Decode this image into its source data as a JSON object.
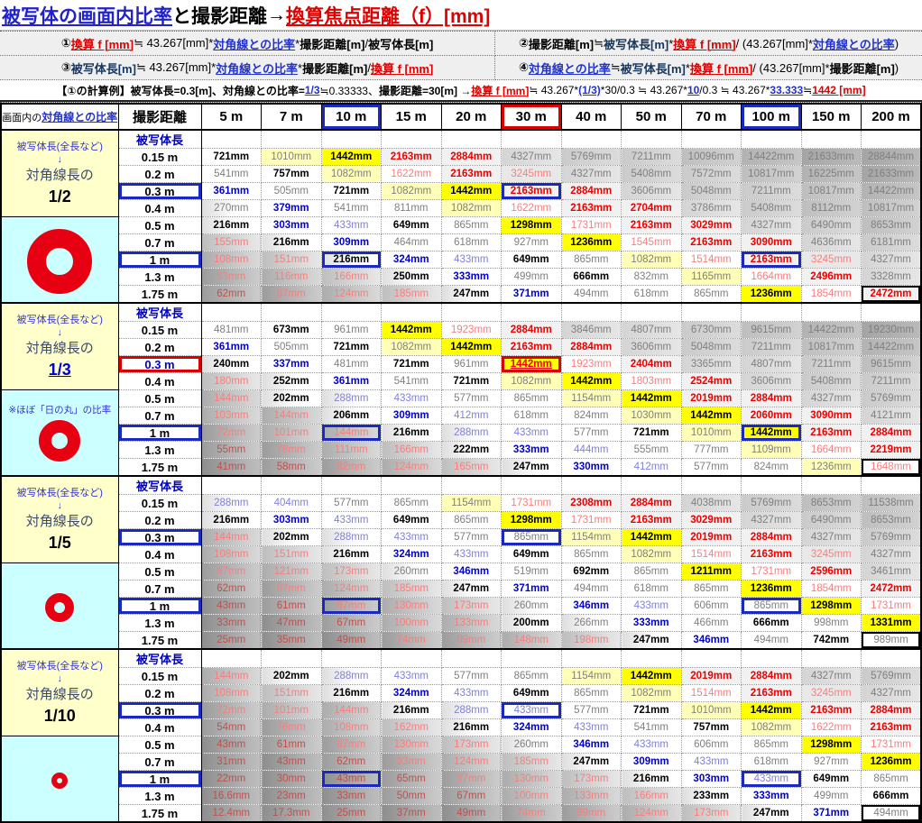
{
  "title": {
    "subject": "被写体の画面内比率",
    "to": "と",
    "distance": "撮影距離",
    "arrow": " → ",
    "result": "換算焦点距離（f）[mm]"
  },
  "formulas": {
    "f1": [
      [
        "①",
        "kb"
      ],
      [
        "換算 f [mm]",
        "r"
      ],
      [
        " ≒ 43.267[mm]*",
        "k"
      ],
      [
        "対角線との比率",
        "b"
      ],
      [
        "*",
        "k"
      ],
      [
        "撮影距離[m]",
        "kb"
      ],
      [
        " / ",
        "k"
      ],
      [
        "被写体長[m]",
        "kb"
      ]
    ],
    "f2": [
      [
        "②",
        "kb"
      ],
      [
        "撮影距離[m]",
        "kb"
      ],
      [
        " ≒ ",
        "k"
      ],
      [
        "被写体長[m]",
        "nb"
      ],
      [
        "*",
        "k"
      ],
      [
        "換算 f [mm]",
        "r"
      ],
      [
        " / (43.267[mm]*",
        "k"
      ],
      [
        "対角線との比率",
        "b"
      ],
      [
        ")",
        "k"
      ]
    ],
    "f3": [
      [
        "③",
        "kb"
      ],
      [
        "被写体長[m]",
        "nb"
      ],
      [
        " ≒ 43.267[mm]*",
        "k"
      ],
      [
        "対角線との比率",
        "b"
      ],
      [
        "*",
        "k"
      ],
      [
        "撮影距離[m]",
        "kb"
      ],
      [
        " / ",
        "k"
      ],
      [
        "換算 f [mm]",
        "r"
      ]
    ],
    "f4": [
      [
        "④",
        "kb"
      ],
      [
        "対角線との比率",
        "b"
      ],
      [
        " ≒ ",
        "k"
      ],
      [
        "被写体長[m]",
        "nb"
      ],
      [
        "*",
        "k"
      ],
      [
        "換算 f [mm]",
        "r"
      ],
      [
        " / (43.267[mm]*",
        "k"
      ],
      [
        "撮影距離[m]",
        "kb"
      ],
      [
        ")",
        "k"
      ]
    ],
    "example": [
      [
        "【①の計算例】",
        "kb"
      ],
      [
        "被写体長=0.3[m]、",
        "kb"
      ],
      [
        "対角線との比率=",
        "kb"
      ],
      [
        "1/3",
        "b"
      ],
      [
        "≒0.33333、",
        "k"
      ],
      [
        "撮影距離=30[m] → ",
        "kb"
      ],
      [
        "換算 f [mm]",
        "r"
      ],
      [
        " ≒ 43.267*",
        "k"
      ],
      [
        "(1/3)",
        "b"
      ],
      [
        "*30/0.3 ≒ 43.267*",
        "k"
      ],
      [
        "10",
        "b"
      ],
      [
        "/0.3 ≒ 43.267*",
        "k"
      ],
      [
        "33.333",
        "b"
      ],
      [
        " ≒ ",
        "k"
      ],
      [
        "1442 [mm]",
        "r"
      ]
    ]
  },
  "table": {
    "corner": {
      "prefix": "画面内の",
      "link": "対角線との比率"
    },
    "distance_header": "撮影距離",
    "subject_header": "被写体長",
    "distances": [
      "5 m",
      "7 m",
      "10 m",
      "15 m",
      "20 m",
      "30 m",
      "40 m",
      "50 m",
      "70 m",
      "100 m",
      "150 m",
      "200 m"
    ],
    "header_boxes": {
      "2": "blue",
      "5": "red",
      "9": "blue"
    },
    "row_labels": [
      "0.15 m",
      "0.2 m",
      "0.3 m",
      "0.4 m",
      "0.5 m",
      "0.7 m",
      "1 m",
      "1.3 m",
      "1.75 m"
    ],
    "sections": [
      {
        "top_label": "被写体長(全長など)",
        "arrow": "↓",
        "diag_label": "対角線長の",
        "fraction": "1/2",
        "fraction_class": "frac-black",
        "note": "",
        "circle": {
          "d": 72,
          "t": 21
        },
        "label_boxes": {
          "2": "blue",
          "6": "blue"
        },
        "label_classes": {},
        "cell_boxes": {
          "2,5": "blue",
          "6,2": "blue",
          "6,9": "blue",
          "8,11": "black"
        },
        "overrides": {},
        "rows": [
          [
            721,
            1010,
            1442,
            2163,
            2884,
            4327,
            5769,
            7211,
            10096,
            14422,
            21633,
            28844
          ],
          [
            541,
            757,
            1082,
            1622,
            2163,
            3245,
            4327,
            5408,
            7572,
            10817,
            16225,
            21633
          ],
          [
            361,
            505,
            721,
            1082,
            1442,
            2163,
            2884,
            3606,
            5048,
            7211,
            10817,
            14422
          ],
          [
            270,
            379,
            541,
            811,
            1082,
            1622,
            2163,
            2704,
            3786,
            5408,
            8112,
            10817
          ],
          [
            216,
            303,
            433,
            649,
            865,
            1298,
            1731,
            2163,
            3029,
            4327,
            6490,
            8653
          ],
          [
            155,
            216,
            309,
            464,
            618,
            927,
            1236,
            1545,
            2163,
            3090,
            4636,
            6181
          ],
          [
            108,
            151,
            216,
            324,
            433,
            649,
            865,
            1082,
            1514,
            2163,
            3245,
            4327
          ],
          [
            83,
            116,
            166,
            250,
            333,
            499,
            666,
            832,
            1165,
            1664,
            2496,
            3328
          ],
          [
            62,
            87,
            124,
            185,
            247,
            371,
            494,
            618,
            865,
            1236,
            1854,
            2472
          ]
        ]
      },
      {
        "top_label": "被写体長(全長など)",
        "arrow": "↓",
        "diag_label": "対角線長の",
        "fraction": "1/3",
        "fraction_class": "frac-blue",
        "note": "※ほぼ「日の丸」の比率",
        "circle": {
          "d": 46,
          "t": 14
        },
        "label_boxes": {
          "2": "red",
          "6": "blue"
        },
        "label_classes": {
          "2": "sub"
        },
        "cell_boxes": {
          "2,5": "red",
          "6,2": "blue",
          "6,9": "blue",
          "8,11": "black"
        },
        "overrides": {
          "2,5": "t-rex b-y",
          "8,10": "t-gray b-ly"
        },
        "rows": [
          [
            481,
            673,
            961,
            1442,
            1923,
            2884,
            3846,
            4807,
            6730,
            9615,
            14422,
            19230
          ],
          [
            361,
            505,
            721,
            1082,
            1442,
            2163,
            2884,
            3606,
            5048,
            7211,
            10817,
            14422
          ],
          [
            240,
            337,
            481,
            721,
            961,
            1442,
            1923,
            2404,
            3365,
            4807,
            7211,
            9615
          ],
          [
            180,
            252,
            361,
            541,
            721,
            1082,
            1442,
            1803,
            2524,
            3606,
            5408,
            7211
          ],
          [
            144,
            202,
            288,
            433,
            577,
            865,
            1154,
            1442,
            2019,
            2884,
            4327,
            5769
          ],
          [
            103,
            144,
            206,
            309,
            412,
            618,
            824,
            1030,
            1442,
            2060,
            3090,
            4121
          ],
          [
            72,
            101,
            144,
            216,
            288,
            433,
            577,
            721,
            1010,
            1442,
            2163,
            2884
          ],
          [
            55,
            78,
            111,
            166,
            222,
            333,
            444,
            555,
            777,
            1109,
            1664,
            2219
          ],
          [
            41,
            58,
            82,
            124,
            165,
            247,
            330,
            412,
            577,
            824,
            1236,
            1648
          ]
        ]
      },
      {
        "top_label": "被写体長(全長など)",
        "arrow": "↓",
        "diag_label": "対角線長の",
        "fraction": "1/5",
        "fraction_class": "frac-black",
        "note": "",
        "circle": {
          "d": 32,
          "t": 10
        },
        "label_boxes": {
          "2": "blue",
          "6": "blue"
        },
        "label_classes": {},
        "cell_boxes": {
          "2,5": "blue",
          "6,2": "blue",
          "6,9": "blue",
          "8,11": "black"
        },
        "overrides": {},
        "rows": [
          [
            288,
            404,
            577,
            865,
            1154,
            1731,
            2308,
            2884,
            4038,
            5769,
            8653,
            11538
          ],
          [
            216,
            303,
            433,
            649,
            865,
            1298,
            1731,
            2163,
            3029,
            4327,
            6490,
            8653
          ],
          [
            144,
            202,
            288,
            433,
            577,
            865,
            1154,
            1442,
            2019,
            2884,
            4327,
            5769
          ],
          [
            108,
            151,
            216,
            324,
            433,
            649,
            865,
            1082,
            1514,
            2163,
            3245,
            4327
          ],
          [
            87,
            121,
            173,
            260,
            346,
            519,
            692,
            865,
            1211,
            1731,
            2596,
            3461
          ],
          [
            62,
            87,
            124,
            185,
            247,
            371,
            494,
            618,
            865,
            1236,
            1854,
            2472
          ],
          [
            43,
            61,
            87,
            130,
            173,
            260,
            346,
            433,
            606,
            865,
            1298,
            1731
          ],
          [
            33,
            47,
            67,
            100,
            133,
            200,
            266,
            333,
            466,
            666,
            998,
            1331
          ],
          [
            25,
            35,
            49,
            74,
            99,
            148,
            198,
            247,
            346,
            494,
            742,
            989
          ]
        ]
      },
      {
        "top_label": "被写体長(全長など)",
        "arrow": "↓",
        "diag_label": "対角線長の",
        "fraction": "1/10",
        "fraction_class": "frac-black",
        "note": "",
        "circle": {
          "d": 18,
          "t": 6
        },
        "label_boxes": {
          "2": "blue",
          "6": "blue"
        },
        "label_classes": {},
        "cell_boxes": {
          "2,5": "blue",
          "6,2": "blue",
          "6,9": "blue",
          "8,11": "black"
        },
        "overrides": {},
        "rows": [
          [
            144,
            202,
            288,
            433,
            577,
            865,
            1154,
            1442,
            2019,
            2884,
            4327,
            5769
          ],
          [
            108,
            151,
            216,
            324,
            433,
            649,
            865,
            1082,
            1514,
            2163,
            3245,
            4327
          ],
          [
            72,
            101,
            144,
            216,
            288,
            433,
            577,
            721,
            1010,
            1442,
            2163,
            2884
          ],
          [
            54,
            76,
            108,
            162,
            216,
            324,
            433,
            541,
            757,
            1082,
            1622,
            2163
          ],
          [
            43,
            61,
            87,
            130,
            173,
            260,
            346,
            433,
            606,
            865,
            1298,
            1731
          ],
          [
            31,
            43,
            62,
            93,
            124,
            185,
            247,
            309,
            433,
            618,
            927,
            1236
          ],
          [
            22,
            30,
            43,
            65,
            87,
            130,
            173,
            216,
            303,
            433,
            649,
            865
          ],
          [
            16.6,
            23,
            33,
            50,
            67,
            100,
            133,
            166,
            233,
            333,
            499,
            666
          ],
          [
            12.4,
            17.3,
            25,
            37,
            49,
            74,
            99,
            124,
            173,
            247,
            371,
            494
          ]
        ]
      }
    ],
    "unit_suffix": "mm",
    "accent_colors": {
      "blue_box": "#1A2AC0",
      "red_box": "#D80000",
      "yellow": "#FFFF00",
      "light_yellow": "#FFFFB8",
      "panel_yellow": "#FFFFCC",
      "panel_cyan": "#CCFFFF",
      "circle_red": "#E60012"
    }
  }
}
